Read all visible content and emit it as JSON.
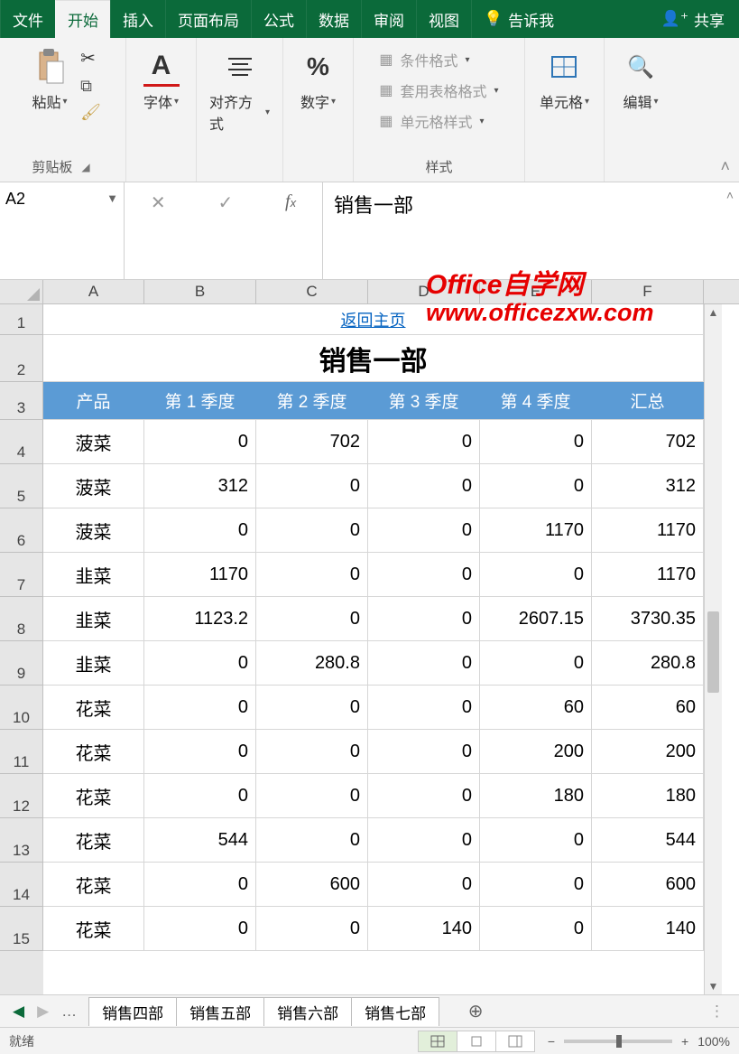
{
  "tabs": {
    "file": "文件",
    "home": "开始",
    "insert": "插入",
    "layout": "页面布局",
    "formulas": "公式",
    "data": "数据",
    "review": "审阅",
    "view": "视图",
    "tell_me": "告诉我",
    "share": "共享"
  },
  "ribbon": {
    "clipboard": {
      "paste": "粘贴",
      "group": "剪贴板"
    },
    "font": {
      "label": "字体"
    },
    "align": {
      "label": "对齐方式"
    },
    "number": {
      "label": "数字"
    },
    "styles": {
      "cond": "条件格式",
      "table": "套用表格格式",
      "cell": "单元格样式",
      "group": "样式"
    },
    "cells": {
      "label": "单元格"
    },
    "editing": {
      "label": "编辑"
    }
  },
  "namebox": "A2",
  "formula": "销售一部",
  "watermark": {
    "l1": "Office自学网",
    "l2": "www.officezxw.com"
  },
  "columns": [
    "A",
    "B",
    "C",
    "D",
    "E",
    "F"
  ],
  "row1_link": "返回主页",
  "row2_title": "销售一部",
  "headers": [
    "产品",
    "第 1 季度",
    "第 2 季度",
    "第 3 季度",
    "第 4 季度",
    "汇总"
  ],
  "rows": [
    {
      "n": 4,
      "p": "菠菜",
      "v": [
        "0",
        "702",
        "0",
        "0",
        "702"
      ]
    },
    {
      "n": 5,
      "p": "菠菜",
      "v": [
        "312",
        "0",
        "0",
        "0",
        "312"
      ]
    },
    {
      "n": 6,
      "p": "菠菜",
      "v": [
        "0",
        "0",
        "0",
        "1170",
        "1170"
      ]
    },
    {
      "n": 7,
      "p": "韭菜",
      "v": [
        "1170",
        "0",
        "0",
        "0",
        "1170"
      ]
    },
    {
      "n": 8,
      "p": "韭菜",
      "v": [
        "1123.2",
        "0",
        "0",
        "2607.15",
        "3730.35"
      ]
    },
    {
      "n": 9,
      "p": "韭菜",
      "v": [
        "0",
        "280.8",
        "0",
        "0",
        "280.8"
      ]
    },
    {
      "n": 10,
      "p": "花菜",
      "v": [
        "0",
        "0",
        "0",
        "60",
        "60"
      ]
    },
    {
      "n": 11,
      "p": "花菜",
      "v": [
        "0",
        "0",
        "0",
        "200",
        "200"
      ]
    },
    {
      "n": 12,
      "p": "花菜",
      "v": [
        "0",
        "0",
        "0",
        "180",
        "180"
      ]
    },
    {
      "n": 13,
      "p": "花菜",
      "v": [
        "544",
        "0",
        "0",
        "0",
        "544"
      ]
    },
    {
      "n": 14,
      "p": "花菜",
      "v": [
        "0",
        "600",
        "0",
        "0",
        "600"
      ]
    },
    {
      "n": 15,
      "p": "花菜",
      "v": [
        "0",
        "0",
        "140",
        "0",
        "140"
      ]
    }
  ],
  "sheet_tabs": [
    "销售四部",
    "销售五部",
    "销售六部",
    "销售七部"
  ],
  "status": {
    "ready": "就绪",
    "zoom": "100%"
  },
  "chart_data": {
    "type": "table",
    "title": "销售一部",
    "columns": [
      "产品",
      "第 1 季度",
      "第 2 季度",
      "第 3 季度",
      "第 4 季度",
      "汇总"
    ],
    "data": [
      [
        "菠菜",
        0,
        702,
        0,
        0,
        702
      ],
      [
        "菠菜",
        312,
        0,
        0,
        0,
        312
      ],
      [
        "菠菜",
        0,
        0,
        0,
        1170,
        1170
      ],
      [
        "韭菜",
        1170,
        0,
        0,
        0,
        1170
      ],
      [
        "韭菜",
        1123.2,
        0,
        0,
        2607.15,
        3730.35
      ],
      [
        "韭菜",
        0,
        280.8,
        0,
        0,
        280.8
      ],
      [
        "花菜",
        0,
        0,
        0,
        60,
        60
      ],
      [
        "花菜",
        0,
        0,
        0,
        200,
        200
      ],
      [
        "花菜",
        0,
        0,
        0,
        180,
        180
      ],
      [
        "花菜",
        544,
        0,
        0,
        0,
        544
      ],
      [
        "花菜",
        0,
        600,
        0,
        0,
        600
      ],
      [
        "花菜",
        0,
        0,
        140,
        0,
        140
      ]
    ]
  }
}
